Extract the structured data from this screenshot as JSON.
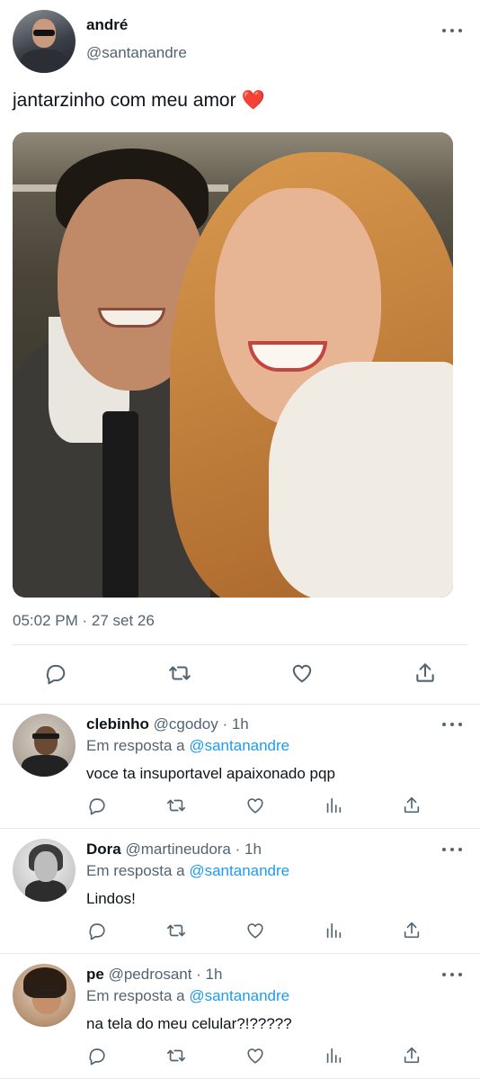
{
  "main_tweet": {
    "display_name": "andré",
    "handle": "@santanandre",
    "text": "jantarzinho com meu amor",
    "emoji": "❤️",
    "photo_icon": "photo",
    "timestamp": "05:02 PM · 27 set 26",
    "actions": [
      "reply-icon",
      "retweet-icon",
      "like-icon",
      "share-icon"
    ]
  },
  "replies": [
    {
      "display_name": "clebinho",
      "meta": "@cgodoy · 1h",
      "in_reply_prefix": "Em resposta a",
      "in_reply_mention": "@santanandre",
      "text": "voce ta insuportavel apaixonado pqp"
    },
    {
      "display_name": "Dora",
      "meta": "@martineudora · 1h",
      "in_reply_prefix": "Em resposta a",
      "in_reply_mention": "@santanandre",
      "text": "Lindos!"
    },
    {
      "display_name": "pe",
      "meta": "@pedrosant · 1h",
      "in_reply_prefix": "Em resposta a",
      "in_reply_mention": "@santanandre",
      "text": "na tela do meu celular?!?????"
    }
  ],
  "colors": {
    "link": "#1d9bf0",
    "secondary_text": "#536471",
    "divider": "#e6e9ec",
    "heart": "#e0245e"
  }
}
